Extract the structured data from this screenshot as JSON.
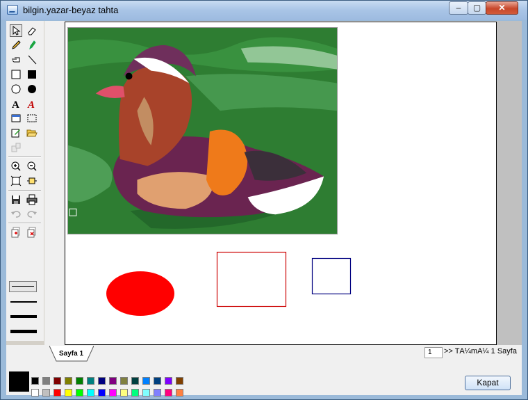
{
  "window": {
    "title": "bilgin.yazar-beyaz tahta",
    "minimize_glyph": "‒",
    "maximize_glyph": "▢",
    "close_glyph": "✕"
  },
  "tabs": [
    {
      "label": "Sayfa 1"
    }
  ],
  "pager": {
    "current_page": "1",
    "all_pages_label": ">> TÃ¼mÃ¼ 1 Sayfa"
  },
  "palette": {
    "current_color": "#000000",
    "row1": [
      "#000000",
      "#808080",
      "#800000",
      "#808000",
      "#008000",
      "#008080",
      "#000080",
      "#800080",
      "#808040",
      "#004040",
      "#0080ff",
      "#004080",
      "#8000ff",
      "#804000"
    ],
    "row2": [
      "#ffffff",
      "#c0c0c0",
      "#ff0000",
      "#ffff00",
      "#00ff00",
      "#00ffff",
      "#0000ff",
      "#ff00ff",
      "#ffff80",
      "#00ff80",
      "#80ffff",
      "#8080ff",
      "#ff0080",
      "#ff8040"
    ]
  },
  "buttons": {
    "close_label": "Kapat"
  },
  "canvas": {
    "shapes": [
      {
        "type": "filled-ellipse",
        "color": "#ff0000"
      },
      {
        "type": "rectangle",
        "color": "#cc0000"
      },
      {
        "type": "rectangle",
        "color": "#000080"
      }
    ]
  },
  "tools": [
    "select-arrow-icon",
    "eraser-icon",
    "pencil-icon",
    "marker-icon",
    "hand-pointer-icon",
    "line-icon",
    "rectangle-icon",
    "filled-rectangle-icon",
    "ellipse-icon",
    "filled-ellipse-icon",
    "text-icon",
    "styled-text-icon",
    "select-rect-icon",
    "select-dashed-icon",
    "edit-image-icon",
    "open-folder-icon",
    "paste-icon",
    "zoom-in-icon",
    "zoom-out-icon",
    "fit-page-icon",
    "fit-width-icon",
    "save-icon",
    "print-icon",
    "undo-icon",
    "redo-icon",
    "add-page-icon",
    "delete-page-icon"
  ]
}
